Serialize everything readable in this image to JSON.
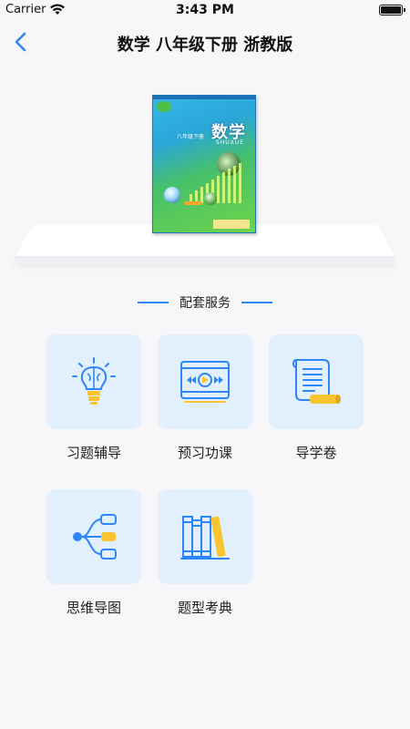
{
  "status_bar": {
    "carrier": "Carrier",
    "time": "3:43 PM",
    "battery_level": 1.0
  },
  "nav": {
    "back_icon": "chevron-left-icon",
    "title": "数学 八年级下册 浙教版"
  },
  "book_cover": {
    "subject": "数学",
    "pinyin": "SHUXUE",
    "grade": "八年级下册"
  },
  "section": {
    "title": "配套服务"
  },
  "services": [
    {
      "label": "习题辅导",
      "icon": "lightbulb-brain-icon"
    },
    {
      "label": "预习功课",
      "icon": "video-player-icon"
    },
    {
      "label": "导学卷",
      "icon": "scroll-document-icon"
    },
    {
      "label": "思维导图",
      "icon": "mind-map-icon"
    },
    {
      "label": "题型考典",
      "icon": "bookshelf-icon"
    }
  ],
  "colors": {
    "accent": "#2e86f4",
    "icon_yellow": "#f8c430",
    "tile_bg": "#e2effc",
    "page_bg": "#f7f7f9"
  }
}
